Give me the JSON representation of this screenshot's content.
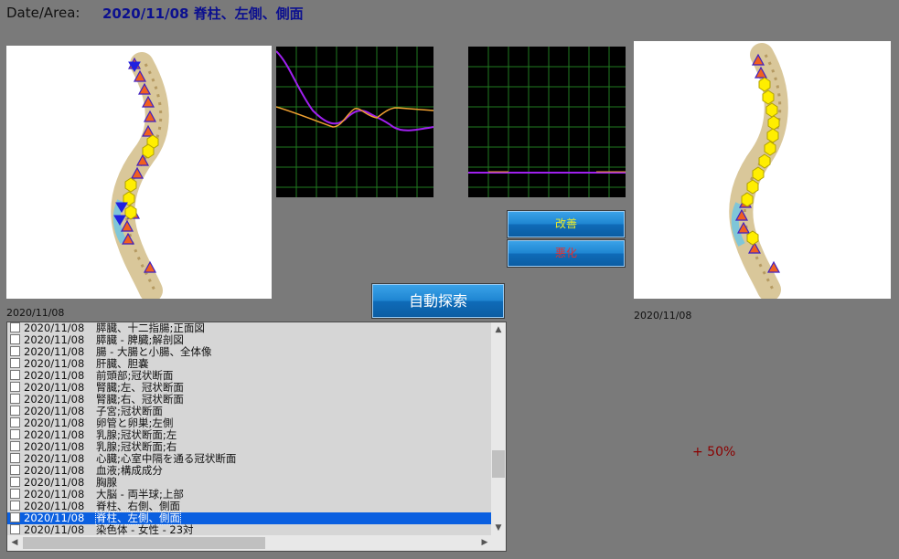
{
  "header": {
    "label": "Date/Area:",
    "value": "2020/11/08  脊柱、左側、側面"
  },
  "buttons": {
    "improve": "改善",
    "worse": "悪化",
    "auto_search": "自動探索"
  },
  "left_image_date": "2020/11/08",
  "right_image_date": "2020/11/08",
  "percent_change": "+ 50%",
  "colors": {
    "background": "#7a7a7a",
    "header_value": "#0c108f",
    "graph_series_a": "#a020f0",
    "graph_series_b": "#f0a030",
    "grid": "#1f7a1f",
    "selection": "#0a5fe0",
    "percent": "#8b0000"
  },
  "list": {
    "items": [
      {
        "date": "2020/11/08",
        "label": "膵臓、十二指腸;正面図",
        "selected": false
      },
      {
        "date": "2020/11/08",
        "label": "膵臓 - 脾臓;解剖図",
        "selected": false
      },
      {
        "date": "2020/11/08",
        "label": "腸 - 大腸と小腸、全体像",
        "selected": false
      },
      {
        "date": "2020/11/08",
        "label": "肝臓、胆嚢",
        "selected": false
      },
      {
        "date": "2020/11/08",
        "label": "前頭部;冠状断面",
        "selected": false
      },
      {
        "date": "2020/11/08",
        "label": "腎臓;左、冠状断面",
        "selected": false
      },
      {
        "date": "2020/11/08",
        "label": "腎臓;右、冠状断面",
        "selected": false
      },
      {
        "date": "2020/11/08",
        "label": "子宮;冠状断面",
        "selected": false
      },
      {
        "date": "2020/11/08",
        "label": "卵管と卵巣;左側",
        "selected": false
      },
      {
        "date": "2020/11/08",
        "label": "乳腺;冠状断面;左",
        "selected": false
      },
      {
        "date": "2020/11/08",
        "label": "乳腺;冠状断面;右",
        "selected": false
      },
      {
        "date": "2020/11/08",
        "label": "心臓;心室中隔を通る冠状断面",
        "selected": false
      },
      {
        "date": "2020/11/08",
        "label": "血液;構成成分",
        "selected": false
      },
      {
        "date": "2020/11/08",
        "label": "胸腺",
        "selected": false
      },
      {
        "date": "2020/11/08",
        "label": "大脳 - 両半球;上部",
        "selected": false
      },
      {
        "date": "2020/11/08",
        "label": "脊柱、右側、側面",
        "selected": false
      },
      {
        "date": "2020/11/08",
        "label": "脊柱、左側、側面",
        "selected": true
      },
      {
        "date": "2020/11/08",
        "label": "染色体 - 女性 - 23対",
        "selected": false
      }
    ]
  }
}
